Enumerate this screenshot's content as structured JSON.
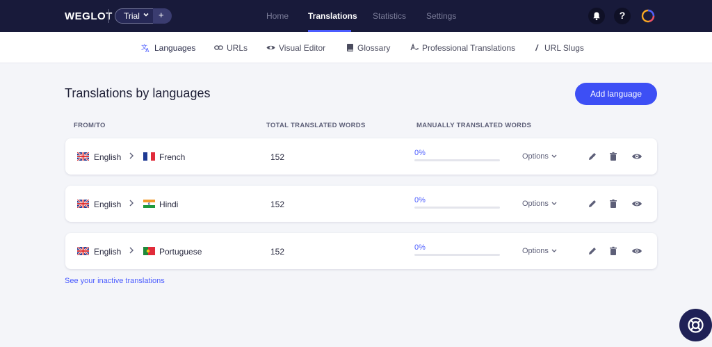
{
  "brand": {
    "logo_text": "WEGLOT",
    "plan_label": "Trial",
    "plan_add": "+"
  },
  "topnav": [
    {
      "label": "Home",
      "active": false
    },
    {
      "label": "Translations",
      "active": true
    },
    {
      "label": "Statistics",
      "active": false
    },
    {
      "label": "Settings",
      "active": false
    }
  ],
  "header_icons": {
    "help_label": "?",
    "notifications": "bell-icon",
    "avatar": "avatar-icon"
  },
  "subnav": [
    {
      "label": "Languages",
      "icon": "translate-icon",
      "active": true
    },
    {
      "label": "URLs",
      "icon": "link-icon",
      "active": false
    },
    {
      "label": "Visual Editor",
      "icon": "eye-icon",
      "active": false
    },
    {
      "label": "Glossary",
      "icon": "book-icon",
      "active": false
    },
    {
      "label": "Professional Translations",
      "icon": "signature-icon",
      "active": false
    },
    {
      "label": "URL Slugs",
      "icon": "slash-icon",
      "active": false
    }
  ],
  "main": {
    "title": "Translations by languages",
    "add_button": "Add language",
    "columns": [
      "FROM/TO",
      "TOTAL TRANSLATED WORDS",
      "MANUALLY TRANSLATED WORDS"
    ],
    "options_label": "Options",
    "rows": [
      {
        "from": "English",
        "to": "French",
        "to_flag": "fr",
        "words": "152",
        "manual_pct_text": "0%",
        "manual_fraction": 0
      },
      {
        "from": "English",
        "to": "Hindi",
        "to_flag": "in",
        "words": "152",
        "manual_pct_text": "0%",
        "manual_fraction": 0
      },
      {
        "from": "English",
        "to": "Portuguese",
        "to_flag": "pt",
        "words": "152",
        "manual_pct_text": "0%",
        "manual_fraction": 0
      }
    ],
    "inactive_link": "See your inactive translations"
  },
  "colors": {
    "topbar": "#181a3a",
    "accent": "#3d4ff5",
    "page_bg": "#f4f5f9"
  }
}
